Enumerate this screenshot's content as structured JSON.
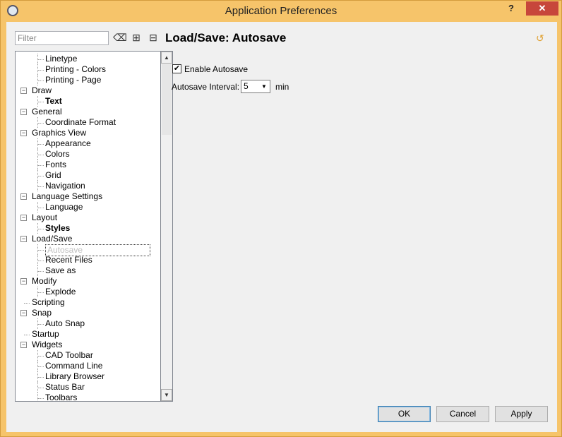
{
  "window": {
    "title": "Application Preferences",
    "help_label": "?",
    "close_label": "✕"
  },
  "filter": {
    "placeholder": "Filter"
  },
  "tree": {
    "rows": [
      {
        "label": "Linetype",
        "level": 1
      },
      {
        "label": "Printing - Colors",
        "level": 1
      },
      {
        "label": "Printing - Page",
        "level": 1
      },
      {
        "label": "Draw",
        "level": 0,
        "expander": true
      },
      {
        "label": "Text",
        "level": 1,
        "bold": true
      },
      {
        "label": "General",
        "level": 0,
        "expander": true
      },
      {
        "label": "Coordinate Format",
        "level": 1
      },
      {
        "label": "Graphics View",
        "level": 0,
        "expander": true
      },
      {
        "label": "Appearance",
        "level": 1
      },
      {
        "label": "Colors",
        "level": 1
      },
      {
        "label": "Fonts",
        "level": 1
      },
      {
        "label": "Grid",
        "level": 1
      },
      {
        "label": "Navigation",
        "level": 1
      },
      {
        "label": "Language Settings",
        "level": 0,
        "expander": true
      },
      {
        "label": "Language",
        "level": 1
      },
      {
        "label": "Layout",
        "level": 0,
        "expander": true
      },
      {
        "label": "Styles",
        "level": 1,
        "bold": true
      },
      {
        "label": "Load/Save",
        "level": 0,
        "expander": true
      },
      {
        "label": "Autosave",
        "level": 1,
        "selected": true
      },
      {
        "label": "Recent Files",
        "level": 1
      },
      {
        "label": "Save as",
        "level": 1
      },
      {
        "label": "Modify",
        "level": 0,
        "expander": true
      },
      {
        "label": "Explode",
        "level": 1
      },
      {
        "label": "Scripting",
        "level": 0
      },
      {
        "label": "Snap",
        "level": 0,
        "expander": true
      },
      {
        "label": "Auto Snap",
        "level": 1
      },
      {
        "label": "Startup",
        "level": 0
      },
      {
        "label": "Widgets",
        "level": 0,
        "expander": true
      },
      {
        "label": "CAD Toolbar",
        "level": 1
      },
      {
        "label": "Command Line",
        "level": 1
      },
      {
        "label": "Library Browser",
        "level": 1
      },
      {
        "label": "Status Bar",
        "level": 1
      },
      {
        "label": "Toolbars",
        "level": 1
      }
    ]
  },
  "page": {
    "title": "Load/Save: Autosave",
    "enable_autosave": {
      "label": "Enable Autosave",
      "checked": true
    },
    "interval": {
      "label": "Autosave Interval:",
      "value": "5",
      "unit": "min"
    }
  },
  "buttons": {
    "ok": "OK",
    "cancel": "Cancel",
    "apply": "Apply"
  },
  "colors": {
    "frame": "#f6c46a",
    "close": "#c7463b",
    "accent_icon": "#e0a030"
  }
}
